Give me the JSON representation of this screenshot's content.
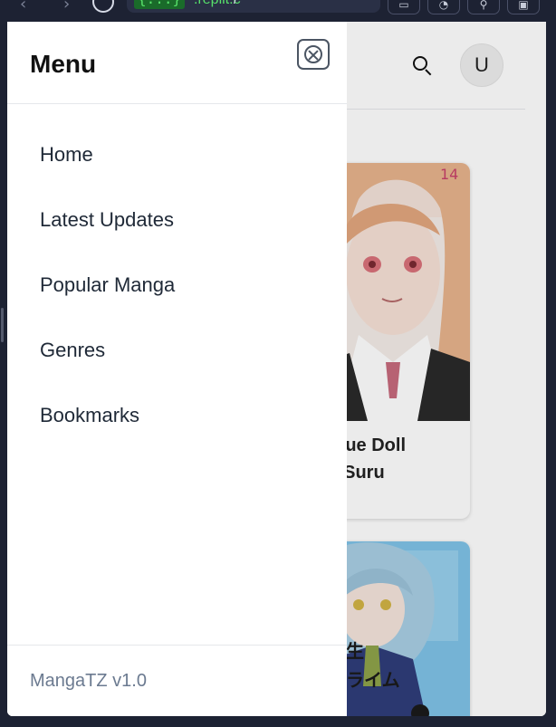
{
  "browser": {
    "url_badge": "{...}",
    "url_text": ".replit.c",
    "url_path": "/",
    "toolbar_icons": [
      "devices-icon",
      "palette-icon",
      "wrench-icon",
      "lock-icon"
    ]
  },
  "header": {
    "search_icon": "search-icon",
    "avatar_initial": "U"
  },
  "cards": [
    {
      "title_line1": "Bisque Doll",
      "title_line2": "oi o Suru",
      "cover_colors": {
        "bg": "#f4ece8",
        "hair": "#e8b48c",
        "skin": "#f7e1d6",
        "uniform": "#2a2a2a"
      }
    },
    {
      "cover_colors": {
        "bg": "#7fc3e8",
        "hair": "#a9cfe4",
        "jacket": "#2f3d7a"
      }
    }
  ],
  "drawer": {
    "title": "Menu",
    "menu_items": [
      "Home",
      "Latest Updates",
      "Popular Manga",
      "Genres",
      "Bookmarks"
    ],
    "version": "MangaTZ v1.0"
  },
  "colors": {
    "page_bg": "#1d2233",
    "drawer_bg": "#ffffff",
    "menu_text": "#1f2937",
    "version_text": "#6b7a90",
    "url_green": "#57e06a"
  }
}
